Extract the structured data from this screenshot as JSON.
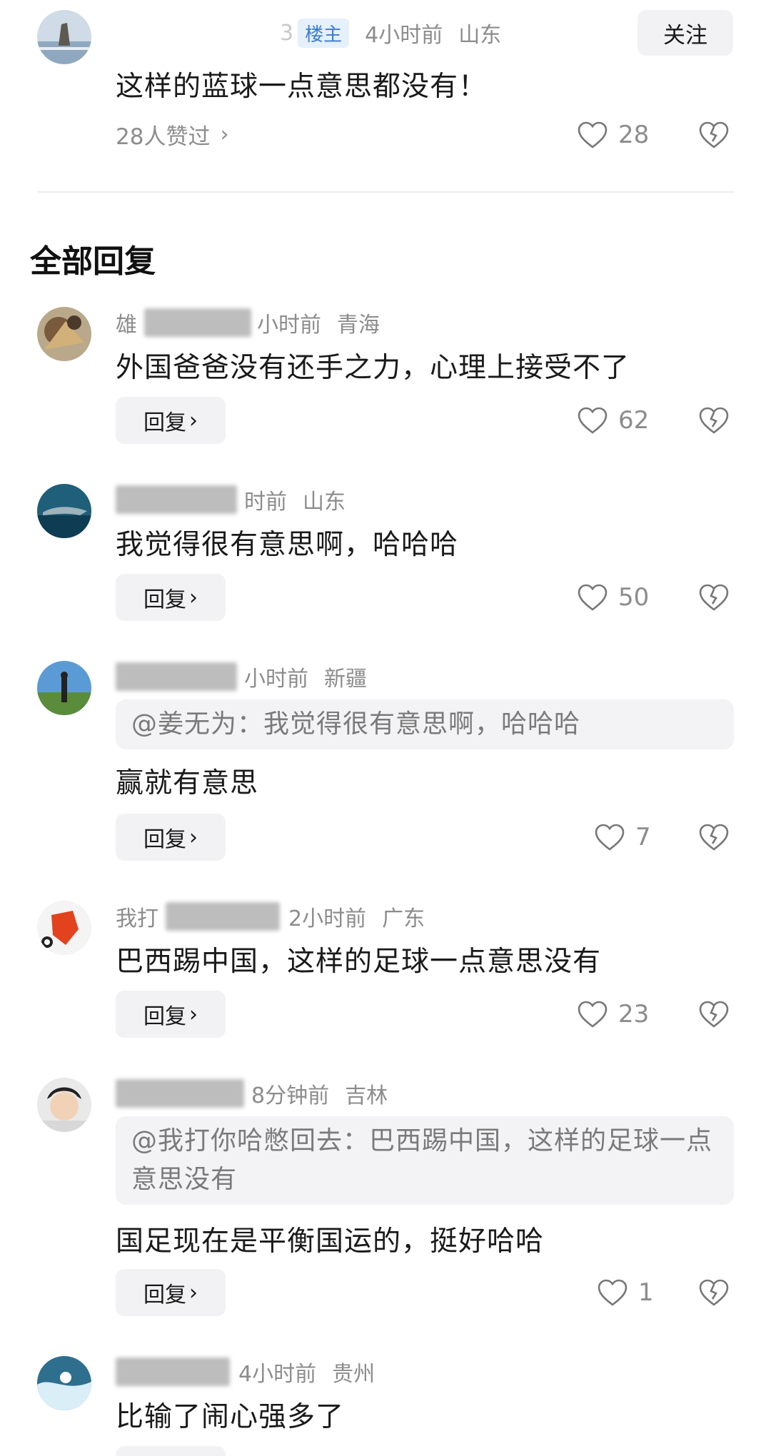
{
  "top_post": {
    "name_tail": "3",
    "badge": "楼主",
    "time": "4小时前",
    "location": "山东",
    "follow_label": "关注",
    "text": "这样的蓝球一点意思都没有！",
    "liked_by": "28人赞过",
    "likes": "28"
  },
  "section_title": "全部回复",
  "comments": [
    {
      "name_visible": "雄",
      "time": "小时前",
      "location": "青海",
      "text": "外国爸爸没有还手之力，心理上接受不了",
      "reply_label": "回复",
      "likes": "62"
    },
    {
      "name_visible": "",
      "time": "时前",
      "location": "山东",
      "text": "我觉得很有意思啊，哈哈哈",
      "reply_label": "回复",
      "likes": "50"
    },
    {
      "name_visible": "",
      "time": "小时前",
      "location": "新疆",
      "quote": "@姜无为：我觉得很有意思啊，哈哈哈",
      "text": "赢就有意思",
      "reply_label": "回复",
      "likes": "7"
    },
    {
      "name_visible": "我打",
      "time": "2小时前",
      "location": "广东",
      "text": "巴西踢中国，这样的足球一点意思没有",
      "reply_label": "回复",
      "likes": "23"
    },
    {
      "name_visible": "",
      "time": "8分钟前",
      "location": "吉林",
      "quote": "@我打你哈憋回去：巴西踢中国，这样的足球一点意思没有",
      "text": "国足现在是平衡国运的，挺好哈哈",
      "reply_label": "回复",
      "likes": "1"
    },
    {
      "name_visible": "",
      "time": "4小时前",
      "location": "贵州",
      "text": "比输了闹心强多了"
    }
  ],
  "colors": {
    "accent_blue": "#3a7bd5",
    "meta_gray": "#8c8c8c",
    "button_bg": "#f2f2f4"
  },
  "icons": [
    "heart-outline-icon",
    "broken-heart-icon",
    "chevron-right-icon"
  ]
}
